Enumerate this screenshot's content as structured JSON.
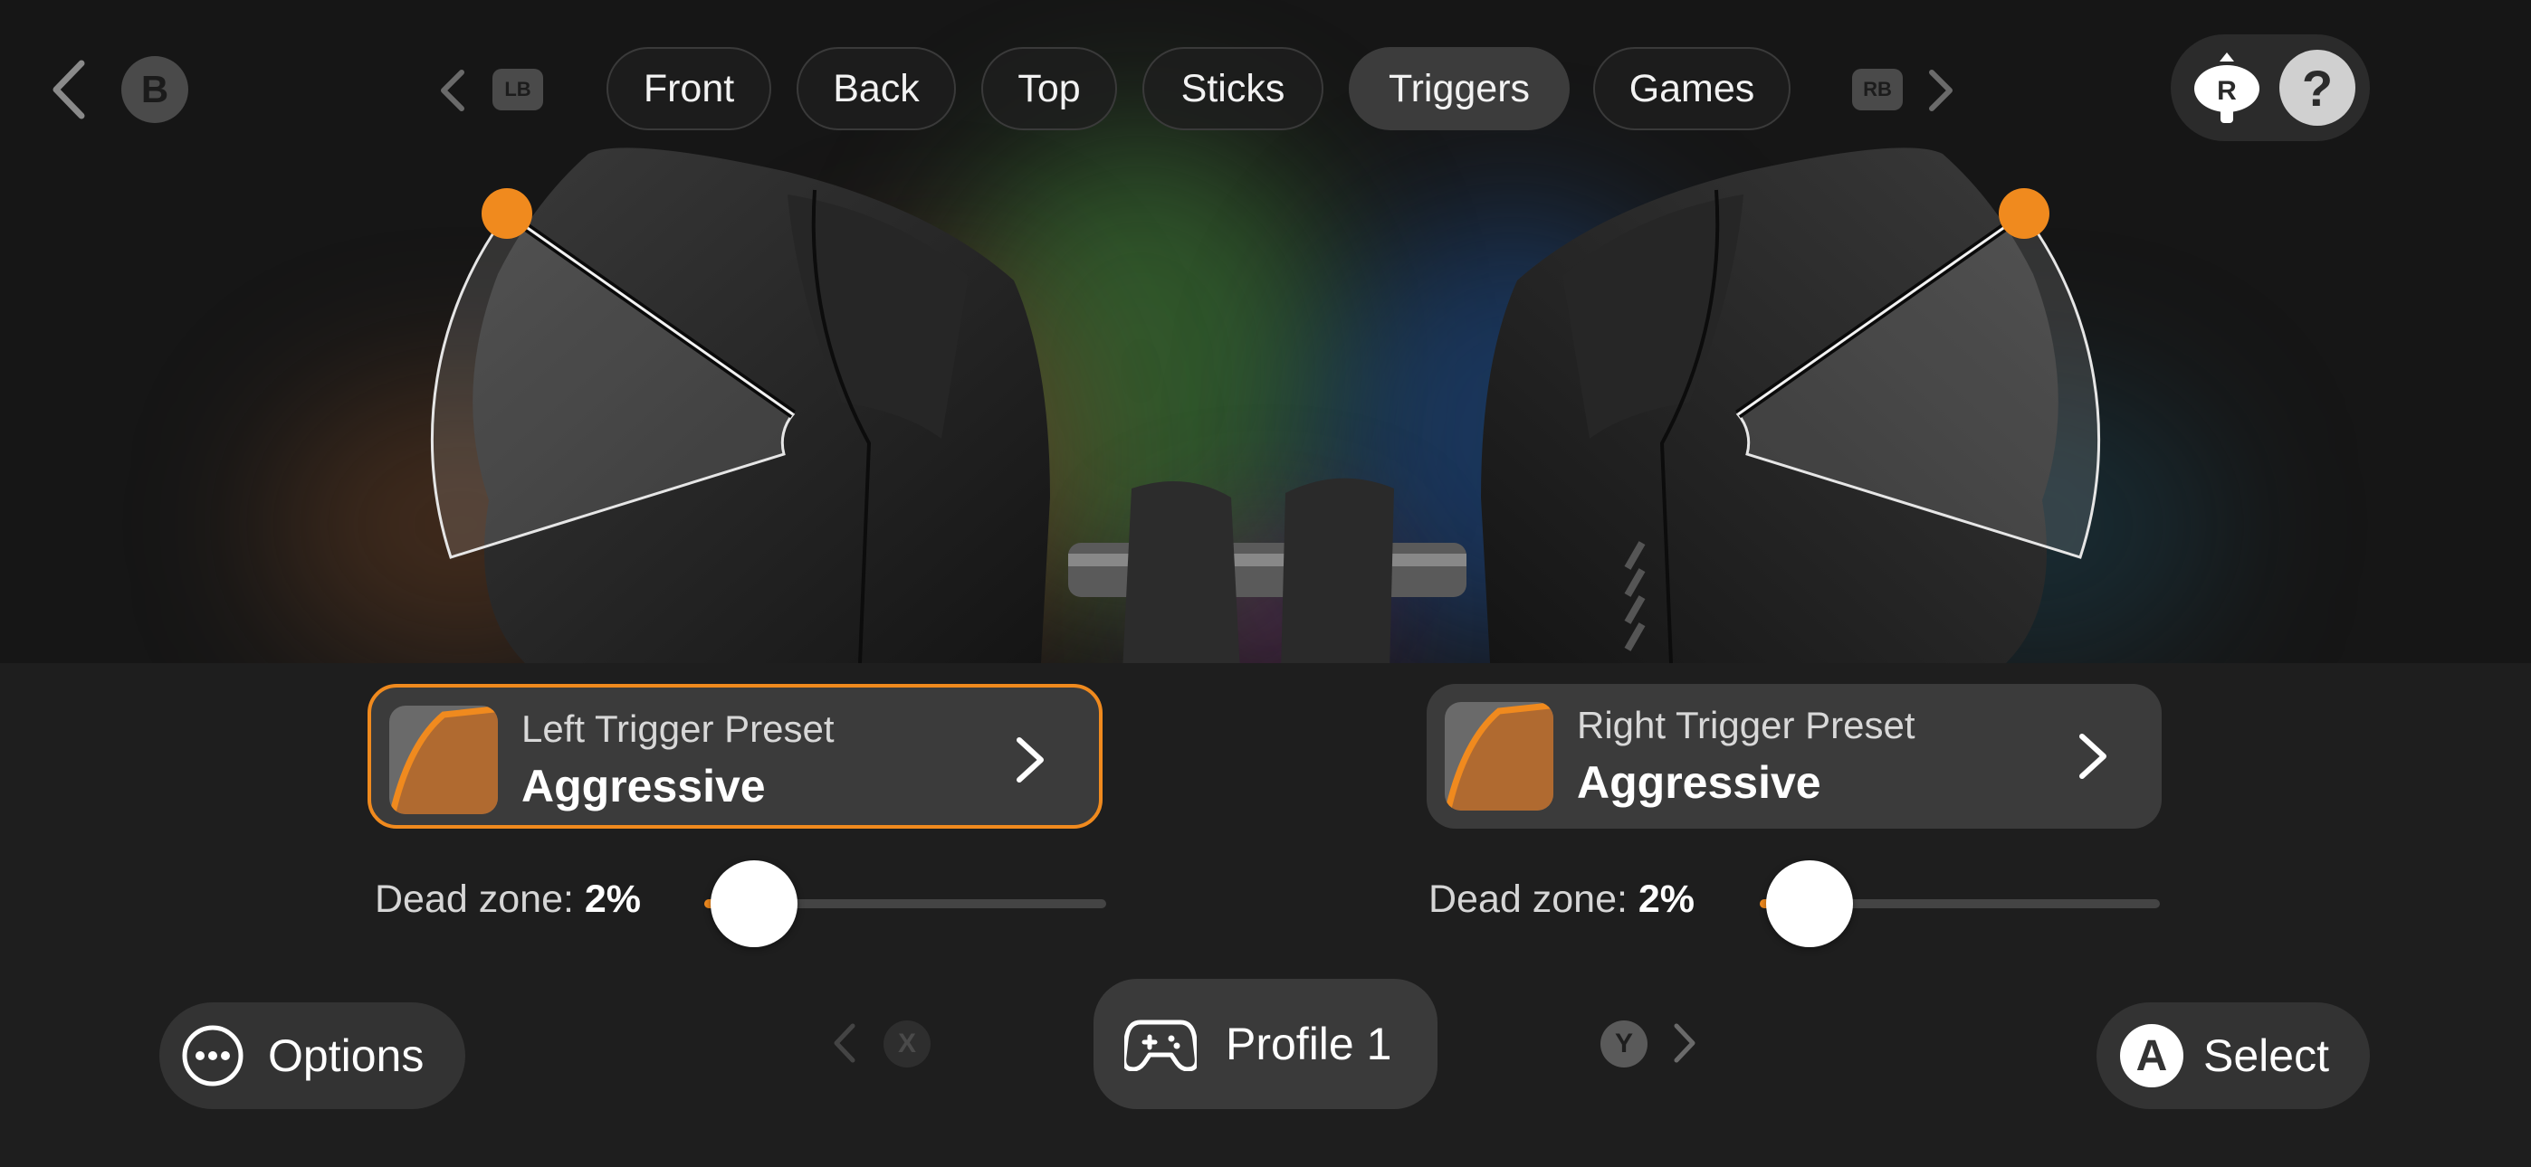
{
  "topbar": {
    "back_badge": "B",
    "lb_badge": "LB",
    "rb_badge": "RB",
    "tabs": [
      {
        "label": "Front"
      },
      {
        "label": "Back"
      },
      {
        "label": "Top"
      },
      {
        "label": "Sticks"
      },
      {
        "label": "Triggers",
        "active": true
      },
      {
        "label": "Games"
      }
    ],
    "r_badge": "R",
    "help_label": "?"
  },
  "left_trigger": {
    "label": "Left Trigger Preset",
    "value": "Aggressive",
    "dead_zone_label": "Dead zone:",
    "dead_zone_value": "2%",
    "dead_zone_fraction": 0.02
  },
  "right_trigger": {
    "label": "Right Trigger Preset",
    "value": "Aggressive",
    "dead_zone_label": "Dead zone:",
    "dead_zone_value": "2%",
    "dead_zone_fraction": 0.02
  },
  "bottombar": {
    "options_label": "Options",
    "profile_label": "Profile 1",
    "prev_badge": "X",
    "next_badge": "Y",
    "select_badge": "A",
    "select_label": "Select"
  },
  "colors": {
    "accent": "#f08a1e",
    "background": "#1e1e1e",
    "card": "#3b3b3b"
  },
  "icons": [
    "chevron-left-icon",
    "chevron-right-icon",
    "gamepad-icon",
    "ellipsis-icon",
    "right-stick-icon",
    "help-icon"
  ]
}
